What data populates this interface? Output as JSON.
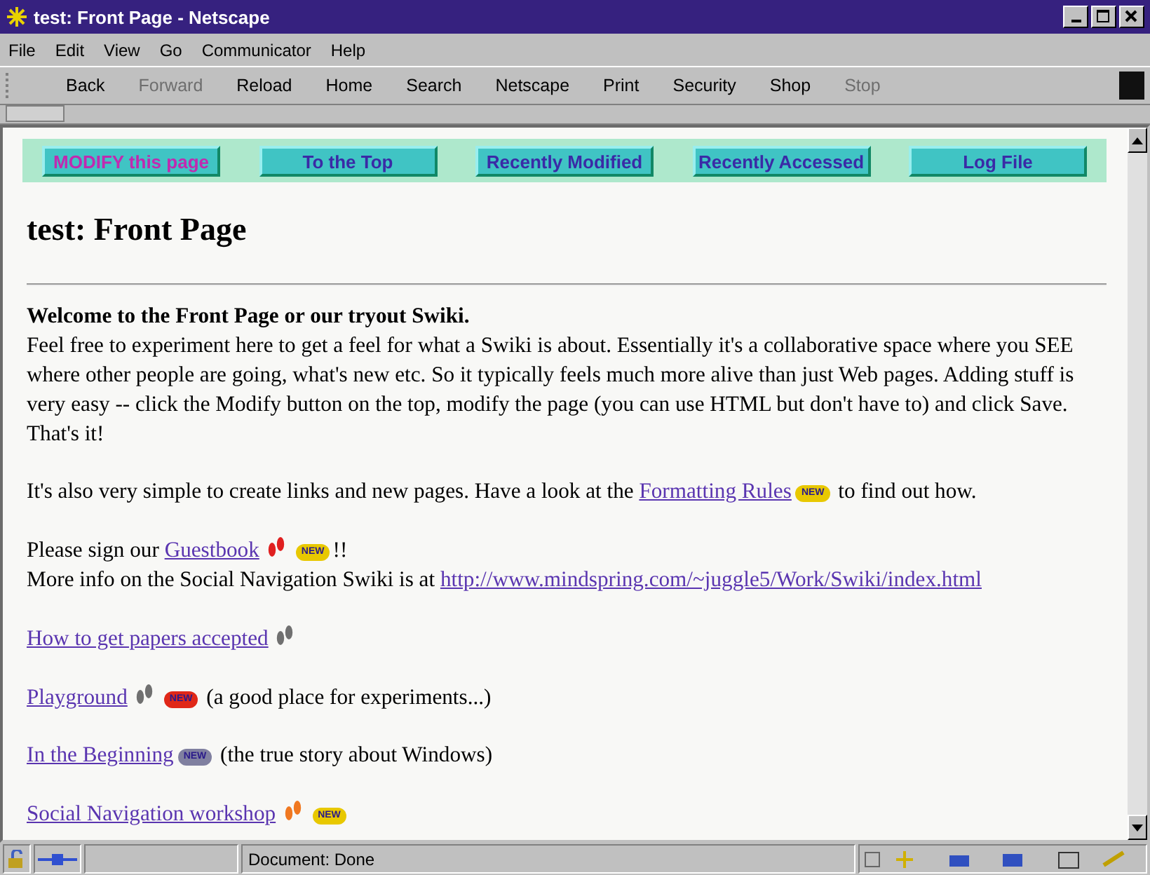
{
  "window": {
    "title": "test: Front Page - Netscape"
  },
  "menu": [
    "File",
    "Edit",
    "View",
    "Go",
    "Communicator",
    "Help"
  ],
  "toolbar": [
    {
      "label": "Back",
      "disabled": false
    },
    {
      "label": "Forward",
      "disabled": true
    },
    {
      "label": "Reload",
      "disabled": false
    },
    {
      "label": "Home",
      "disabled": false
    },
    {
      "label": "Search",
      "disabled": false
    },
    {
      "label": "Netscape",
      "disabled": false
    },
    {
      "label": "Print",
      "disabled": false
    },
    {
      "label": "Security",
      "disabled": false
    },
    {
      "label": "Shop",
      "disabled": false
    },
    {
      "label": "Stop",
      "disabled": true
    }
  ],
  "nav_buttons": [
    {
      "label": "MODIFY this page",
      "highlighted": true
    },
    {
      "label": "To the Top",
      "highlighted": false
    },
    {
      "label": "Recently Modified",
      "highlighted": false
    },
    {
      "label": "Recently Accessed",
      "highlighted": false
    },
    {
      "label": "Log File",
      "highlighted": false
    }
  ],
  "heading": "test: Front Page",
  "blocks": [
    {
      "lines": [
        [
          {
            "kind": "bold",
            "text": "Welcome to the Front Page or our tryout Swiki."
          }
        ],
        [
          {
            "kind": "text",
            "text": "Feel free to experiment here to get a feel for what a Swiki is about. Essentially it's a collaborative space where you SEE where other people are going, what's new etc. So it typically feels much more alive than just Web pages. Adding stuff is very easy -- click the Modify button on the top, modify the page (you can use HTML but don't have to) and click Save. That's it!"
          }
        ]
      ]
    },
    {
      "lines": [
        [
          {
            "kind": "text",
            "text": "It's also very simple to create links and new pages. Have a look at the "
          },
          {
            "kind": "link",
            "text": "Formatting Rules"
          },
          {
            "kind": "badge",
            "text": "NEW",
            "color": "#e8c800"
          },
          {
            "kind": "text",
            "text": " to find out how."
          }
        ]
      ]
    },
    {
      "lines": [
        [
          {
            "kind": "text",
            "text": "Please sign our "
          },
          {
            "kind": "link",
            "text": "Guestbook"
          },
          {
            "kind": "foot",
            "color": "#e02020"
          },
          {
            "kind": "badge",
            "text": "NEW",
            "color": "#e8c800"
          },
          {
            "kind": "text",
            "text": "!!"
          }
        ],
        [
          {
            "kind": "text",
            "text": "More info on the Social Navigation Swiki is at "
          },
          {
            "kind": "link",
            "text": "http://www.mindspring.com/~juggle5/Work/Swiki/index.html"
          }
        ]
      ]
    },
    {
      "lines": [
        [
          {
            "kind": "link",
            "text": "How to get papers accepted"
          },
          {
            "kind": "foot",
            "color": "#707070"
          }
        ]
      ]
    },
    {
      "lines": [
        [
          {
            "kind": "link",
            "text": "Playground"
          },
          {
            "kind": "foot",
            "color": "#707070"
          },
          {
            "kind": "badge",
            "text": "NEW",
            "color": "#e02818"
          },
          {
            "kind": "text",
            "text": " (a good place for experiments...)"
          }
        ]
      ]
    },
    {
      "lines": [
        [
          {
            "kind": "link",
            "text": "In the Beginning"
          },
          {
            "kind": "badge",
            "text": "NEW",
            "color": "#8080a0"
          },
          {
            "kind": "text",
            "text": " (the true story about Windows)"
          }
        ]
      ]
    },
    {
      "lines": [
        [
          {
            "kind": "link",
            "text": "Social Navigation workshop"
          },
          {
            "kind": "foot",
            "color": "#f07820"
          },
          {
            "kind": "badge",
            "text": "NEW",
            "color": "#e8c800"
          }
        ]
      ]
    }
  ],
  "status_bar": {
    "text": "Document: Done"
  }
}
